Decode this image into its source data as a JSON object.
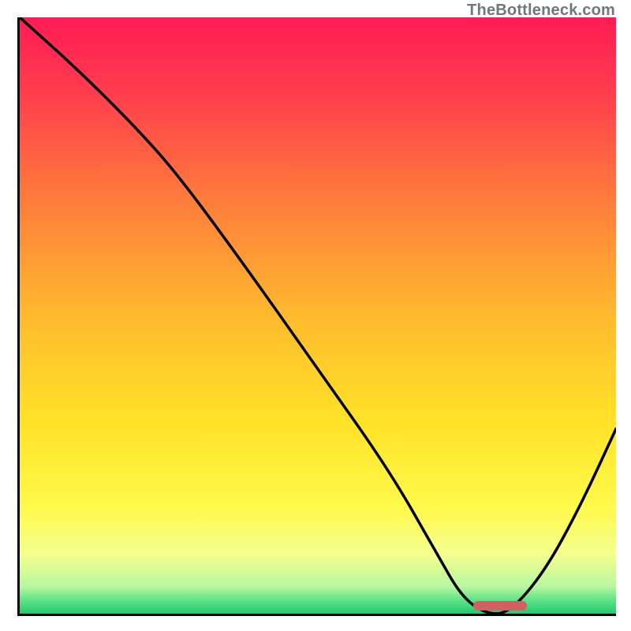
{
  "watermark": "TheBottleneck.com",
  "chart_data": {
    "type": "line",
    "title": "",
    "xlabel": "",
    "ylabel": "",
    "x_range": [
      0,
      100
    ],
    "y_range": [
      0,
      100
    ],
    "grid": false,
    "legend": false,
    "gradient_stops": [
      {
        "offset": 0.0,
        "color": "#ff1c55"
      },
      {
        "offset": 0.12,
        "color": "#ff3b4e"
      },
      {
        "offset": 0.3,
        "color": "#ff7a3c"
      },
      {
        "offset": 0.5,
        "color": "#ffba2e"
      },
      {
        "offset": 0.68,
        "color": "#ffe327"
      },
      {
        "offset": 0.82,
        "color": "#fff94a"
      },
      {
        "offset": 0.9,
        "color": "#f4ff8f"
      },
      {
        "offset": 0.955,
        "color": "#b8f7a0"
      },
      {
        "offset": 0.975,
        "color": "#66e589"
      },
      {
        "offset": 1.0,
        "color": "#22c96f"
      }
    ],
    "series": [
      {
        "name": "bottleneck-curve",
        "x": [
          0,
          10,
          20,
          27,
          38,
          50,
          62,
          70,
          74,
          78,
          82,
          88,
          94,
          100
        ],
        "y": [
          100,
          91,
          81,
          73,
          58,
          41,
          24,
          10,
          3,
          0,
          0,
          7,
          18,
          31
        ]
      }
    ],
    "marker": {
      "x_start": 76,
      "x_end": 85,
      "color": "#cf6161"
    }
  }
}
